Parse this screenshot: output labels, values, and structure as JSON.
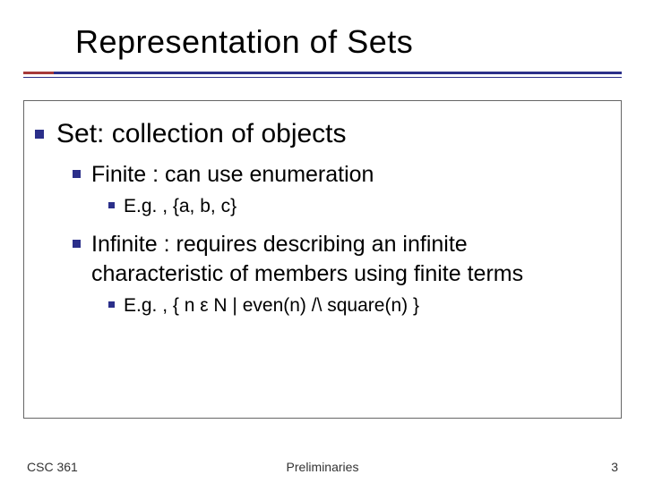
{
  "title": "Representation of Sets",
  "bullets": {
    "lvl1": "Set: collection of objects",
    "finite": "Finite : can use enumeration",
    "finite_eg": "E.g. , {a, b, c}",
    "infinite": "Infinite : requires describing an infinite characteristic of members using finite terms",
    "infinite_eg": "E.g. , { n ε N | even(n) /\\ square(n) }"
  },
  "footer": {
    "left": "CSC 361",
    "center": "Preliminaries",
    "right": "3"
  }
}
